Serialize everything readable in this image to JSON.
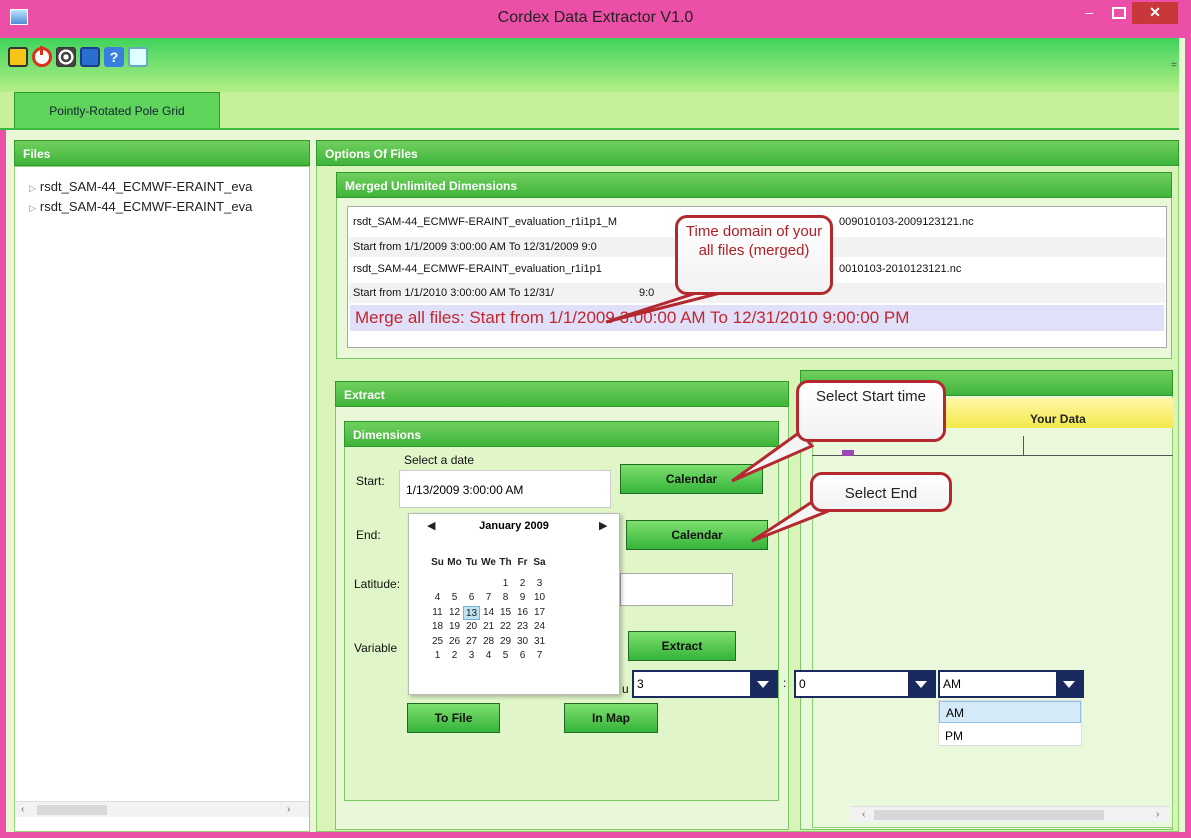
{
  "window": {
    "title": "Cordex Data Extractor V1.0"
  },
  "toolbar": {
    "icons": [
      "open-icon",
      "power-icon",
      "target-icon",
      "monitor-icon",
      "help-icon",
      "settings-icon"
    ],
    "grip": "="
  },
  "tabs": {
    "active": "Pointly-Rotated Pole Grid"
  },
  "files_panel": {
    "title": "Files",
    "items": [
      "rsdt_SAM-44_ECMWF-ERAINT_eva",
      "rsdt_SAM-44_ECMWF-ERAINT_eva"
    ]
  },
  "options_panel": {
    "title": "Options Of Files",
    "merged_title": "Merged Unlimited Dimensions",
    "rows": [
      "rsdt_SAM-44_ECMWF-ERAINT_evaluation_r1i1p1_M",
      "009010103-2009123121.nc",
      "Start from 1/1/2009 3:00:00 AM To 12/31/2009 9:0",
      "rsdt_SAM-44_ECMWF-ERAINT_evaluation_r1i1p1",
      "0010103-2010123121.nc",
      "Start from 1/1/2010 3:00:00 AM To 12/31/",
      "9:0"
    ],
    "merge_all": "Merge all files: Start from 1/1/2009 3:00:00 AM To 12/31/2010 9:00:00 PM"
  },
  "extract_panel": {
    "title": "Extract",
    "dimensions_title": "Dimensions",
    "select_date_label": "Select a date",
    "start_label": "Start:",
    "start_value": "1/13/2009 3:00:00 AM",
    "end_label": "End:",
    "latitude_label": "Latitude:",
    "variable_label": "Variable",
    "calendar_start_button": "Calendar",
    "calendar_end_button": "Calendar",
    "extract_button": "Extract",
    "to_file_button": "To File",
    "in_map_button": "In Map",
    "partial_text": "u"
  },
  "calendar": {
    "month": "January 2009",
    "prev": "◀",
    "next": "▶",
    "days_of_week": [
      "Su",
      "Mo",
      "Tu",
      "We",
      "Th",
      "Fr",
      "Sa"
    ],
    "weeks": [
      [
        "",
        "",
        "",
        "",
        "1",
        "2",
        "3"
      ],
      [
        "4",
        "5",
        "6",
        "7",
        "8",
        "9",
        "10"
      ],
      [
        "11",
        "12",
        "13",
        "14",
        "15",
        "16",
        "17"
      ],
      [
        "18",
        "19",
        "20",
        "21",
        "22",
        "23",
        "24"
      ],
      [
        "25",
        "26",
        "27",
        "28",
        "29",
        "30",
        "31"
      ],
      [
        "1",
        "2",
        "3",
        "4",
        "5",
        "6",
        "7"
      ]
    ],
    "selected_day": "13"
  },
  "time_selectors": {
    "hour": "3",
    "minute": "0",
    "ampm": "AM",
    "colon": ":",
    "ampm_options": [
      "AM",
      "PM"
    ]
  },
  "right_panel": {
    "column_header": "Your Data"
  },
  "callouts": {
    "time_domain": "Time domain of your all files (merged)",
    "select_start": "Select Start time",
    "select_end": "Select End"
  },
  "colors": {
    "titlebar": "#ec4fa8",
    "accent_green": "#3fb43a",
    "callout_border": "#b4292f",
    "merge_text": "#c3262e"
  }
}
